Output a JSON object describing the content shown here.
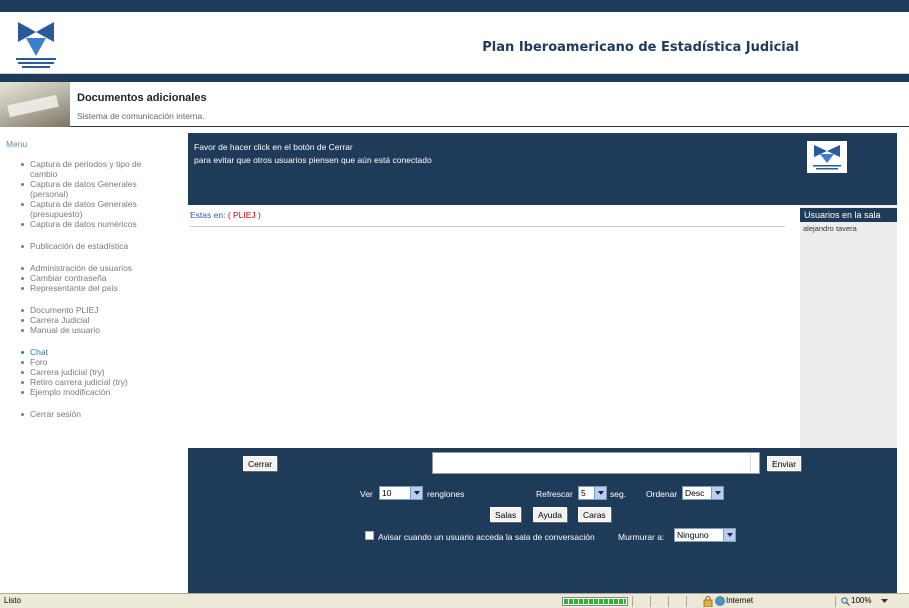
{
  "header": {
    "title": "Plan Iberoamericano de Estadística Judicial"
  },
  "subheader": {
    "title": "Documentos adicionales",
    "description": "Sistema de comunicación interna."
  },
  "menu": {
    "title": "Menu",
    "items": [
      {
        "label": "Captura de periodos y tipo de cambio"
      },
      {
        "label": "Captura de datos Generales (personal)"
      },
      {
        "label": "Captura de datos Generales (presupuesto)"
      },
      {
        "label": "Captura de datos numéricos"
      },
      {
        "label": "Publicación de estadística"
      },
      {
        "label": "Administración de usuarios"
      },
      {
        "label": "Cambiar contraseña"
      },
      {
        "label": "Representante del país"
      },
      {
        "label": "Documento PLIEJ"
      },
      {
        "label": "Carrera Judicial"
      },
      {
        "label": "Manual de usuario"
      },
      {
        "label": "Chat"
      },
      {
        "label": "Foro"
      },
      {
        "label": "Carrera judicial (try)"
      },
      {
        "label": "Retiro carrera judicial (try)"
      },
      {
        "label": "Ejemplo modificación"
      },
      {
        "label": "Cerrar sesión"
      }
    ]
  },
  "notice": {
    "line1": "Favor de hacer click en el botón de Cerrar",
    "line2": "para evitar que otros usuarios piensen que aún está conectado"
  },
  "chat": {
    "location_label": "Estas en:",
    "location_value": "( PLIEJ )"
  },
  "users_panel": {
    "title": "Usuarios en la sala",
    "users": [
      "alejandro tavera"
    ]
  },
  "controls": {
    "close_label": "Cerrar",
    "send_label": "Enviar",
    "message_value": "",
    "ver_label": "Ver",
    "ver_value": "10",
    "renglones_label": "renglones",
    "refrescar_label": "Refrescar",
    "refrescar_value": "5",
    "seg_label": "seg.",
    "ordenar_label": "Ordenar",
    "ordenar_value": "Desc",
    "salas_label": "Salas",
    "ayuda_label": "Ayuda",
    "caras_label": "Caras",
    "avisar_label": "Avisar cuando un usuario acceda la sala de conversación",
    "avisar_checked": false,
    "murmurar_label": "Murmurar a:",
    "murmurar_value": "Ninguno"
  },
  "statusbar": {
    "status": "Listo",
    "zone": "Internet",
    "zoom": "100%",
    "progress": 1.0
  },
  "colors": {
    "navy": "#1f3b5a",
    "menu_link": "#7a7a7a",
    "active_link": "#2f7a99",
    "breadcrumb": "#d40000"
  }
}
